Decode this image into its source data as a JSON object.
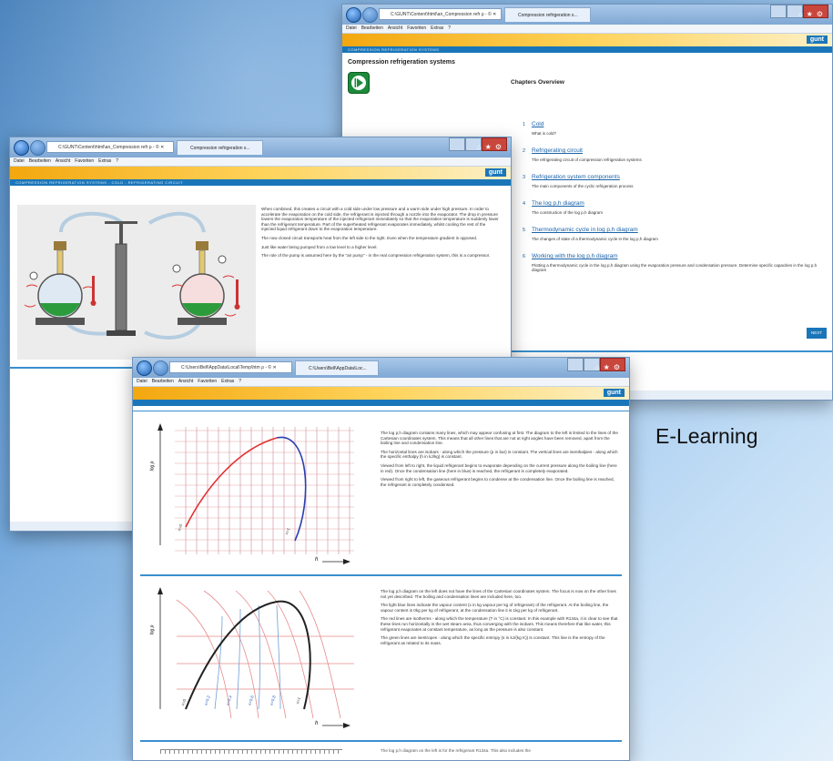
{
  "e_learning_label": "E-Learning",
  "window_back": {
    "address": "C:\\GUNT\\Content\\html\\an_Compression refr ρ - © ✕",
    "tab": "Compression refrigeration s...",
    "menu": [
      "Datei",
      "Bearbeiten",
      "Ansicht",
      "Favoriten",
      "Extras",
      "?"
    ],
    "brand": "gunt",
    "band_title": "COMPRESSION REFRIGERATION SYSTEMS",
    "page_title": "Compression refrigeration systems",
    "chapters_heading": "Chapters Overview",
    "chapters": [
      {
        "num": "1",
        "title": "Cold",
        "desc": "What is cold?"
      },
      {
        "num": "2",
        "title": "Refrigerating circuit",
        "desc": "The refrigerating circuit of compression refrigeration systems"
      },
      {
        "num": "3",
        "title": "Refrigeration system components",
        "desc": "The main components of the cyclic refrigeration process"
      },
      {
        "num": "4",
        "title": "The log p,h diagram",
        "desc": "The construction of the log p,h diagram"
      },
      {
        "num": "5",
        "title": "Thermodynamic cycle in log p,h diagram",
        "desc": "The changes of state of a thermodynamic cycle in the log p,h diagram"
      },
      {
        "num": "6",
        "title": "Working with the log p,h diagram",
        "desc": "Plotting a thermodynamic cycle in the log p,h diagram using the evaporation pressure and condensation pressure. Determine specific capacities in the log p,h diagram"
      }
    ],
    "next_label": "NEXT"
  },
  "window_mid": {
    "address": "C:\\GUNT\\Content\\html\\an_Compression refr ρ - © ✕",
    "tab": "Compression refrigeration s...",
    "menu": [
      "Datei",
      "Bearbeiten",
      "Ansicht",
      "Favoriten",
      "Extras",
      "?"
    ],
    "brand": "gunt",
    "band_title": "COMPRESSION REFRIGERATION SYSTEMS - COLD - REFRIGERATING CIRCUIT",
    "paragraphs": [
      "When combined, this creates a circuit with a cold side under low pressure and a warm side under high pressure. In order to accelerate the evaporation on the cold side, the refrigerant is injected through a nozzle into the evaporator. The drop in pressure lowers the evaporation temperature of the injected refrigerant immediately so that the evaporation temperature is suddenly lower than the refrigerant temperature. Part of the superheated refrigerant evaporates immediately, whilst cooling the rest of the injected liquid refrigerant down to the evaporation temperature.",
      "The now closed circuit transports heat from the left side to the right. Even when the temperature gradient is opposed.",
      "Just like water being pumped from a low level to a higher level.",
      "The role of the pump is assumed here by the \"air pump\" - in the real compression refrigeration system, this is a compressor."
    ]
  },
  "window_front": {
    "address": "C:\\Users\\Bell\\AppData\\Local\\Temp\\htm ρ - © ✕",
    "tab": "C:\\Users\\Bell\\AppData\\Loc...",
    "menu": [
      "Datei",
      "Bearbeiten",
      "Ansicht",
      "Favoriten",
      "Extras",
      "?"
    ],
    "brand": "gunt",
    "axis_y": "log p",
    "axis_x": "h",
    "curve_label_0": "x=0",
    "curve_label_1": "x=1",
    "vapour_labels": [
      "x=0.2",
      "x=0.4",
      "x=0.6",
      "x=0.8"
    ],
    "section1": [
      "The log p,h diagram contains many lines, which may appear confusing at first. The diagram to the left is limited to the lines of the Cartesian coordinates system. This means that all other lines that are not at right angles have been removed, apart from the boiling line and condensation line.",
      "The horizontal lines are isobars - along which the pressure (p in bar) is constant. The vertical lines are isenthalpies - along which the specific enthalpy (h in kJ/kg) is constant.",
      "Viewed from left to right, the liquid refrigerant begins to evaporate depending on the current pressure along the boiling line (here in red). Once the condensation line (here in blue) is reached, the refrigerant is completely evaporated.",
      "Viewed from right to left, the gaseous refrigerant begins to condense at the condensation line. Once the boiling line is reached, the refrigerant is completely condensed."
    ],
    "section2": [
      "The log p,h diagram on the left does not have the lines of the Cartesian coordinates system. The focus is now on the other lines not yet described. The boiling and condensation lines are included here, too.",
      "The light blue lines indicate the vapour content (x in kg vapour per kg of refrigerant) of the refrigerant. At the boiling line, the vapour content is 0kg per kg of refrigerant, at the condensation line it is 1kg per kg of refrigerant.",
      "The red lines are isotherms - along which the temperature (T in °C) is constant. In this example with R134a, it is clear to see that these lines run horizontally in the wet steam area, thus converging with the isobars. This means therefore that like water, this refrigerant evaporates at constant temperature, as long as the pressure is also constant.",
      "The green lines are isentropes - along which the specific entropy (s in kJ/(kg K)) is constant. This line is the entropy of the refrigerant as related to its mass."
    ],
    "section3_cut": "The log p,h diagram on the left is for the refrigerant R134a. This also includes the"
  }
}
